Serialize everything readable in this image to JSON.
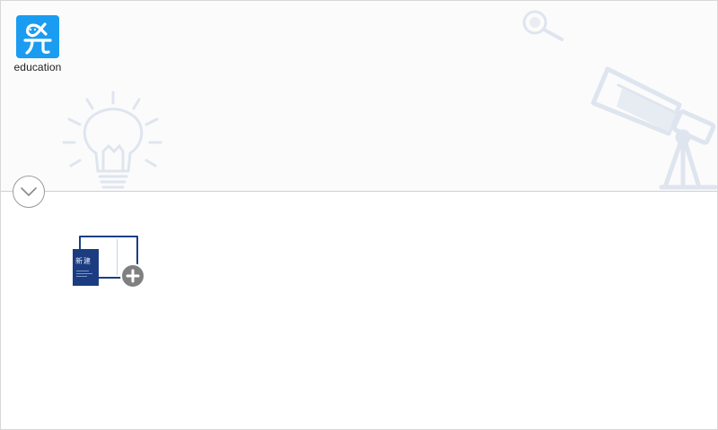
{
  "logo": {
    "label": "education",
    "icon": "education-logo-icon",
    "color": "#1a9cf0"
  },
  "banner": {
    "decorations": [
      "lightbulb-icon",
      "magnifier-icon",
      "telescope-icon"
    ],
    "decoration_color": "#dfe5ef"
  },
  "toggle": {
    "icon": "chevron-down-icon"
  },
  "new_book": {
    "title": "新建",
    "icon": "plus-icon",
    "cover_color": "#1b3c80"
  }
}
